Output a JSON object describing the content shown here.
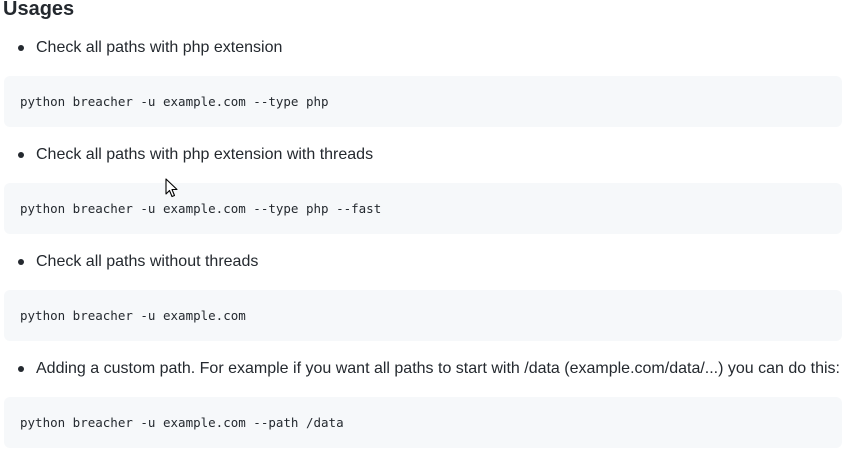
{
  "section": {
    "title": "Usages"
  },
  "usages": [
    {
      "description": "Check all paths with php extension",
      "command": "python breacher -u example.com --type php"
    },
    {
      "description": "Check all paths with php extension with threads",
      "command": "python breacher -u example.com --type php --fast"
    },
    {
      "description": "Check all paths without threads",
      "command": "python breacher -u example.com"
    },
    {
      "description": "Adding a custom path. For example if you want all paths to start with /data (example.com/data/...) you can do this:",
      "command": "python breacher -u example.com --path /data"
    }
  ],
  "icons": {
    "cursor": "mouse-pointer-icon"
  }
}
